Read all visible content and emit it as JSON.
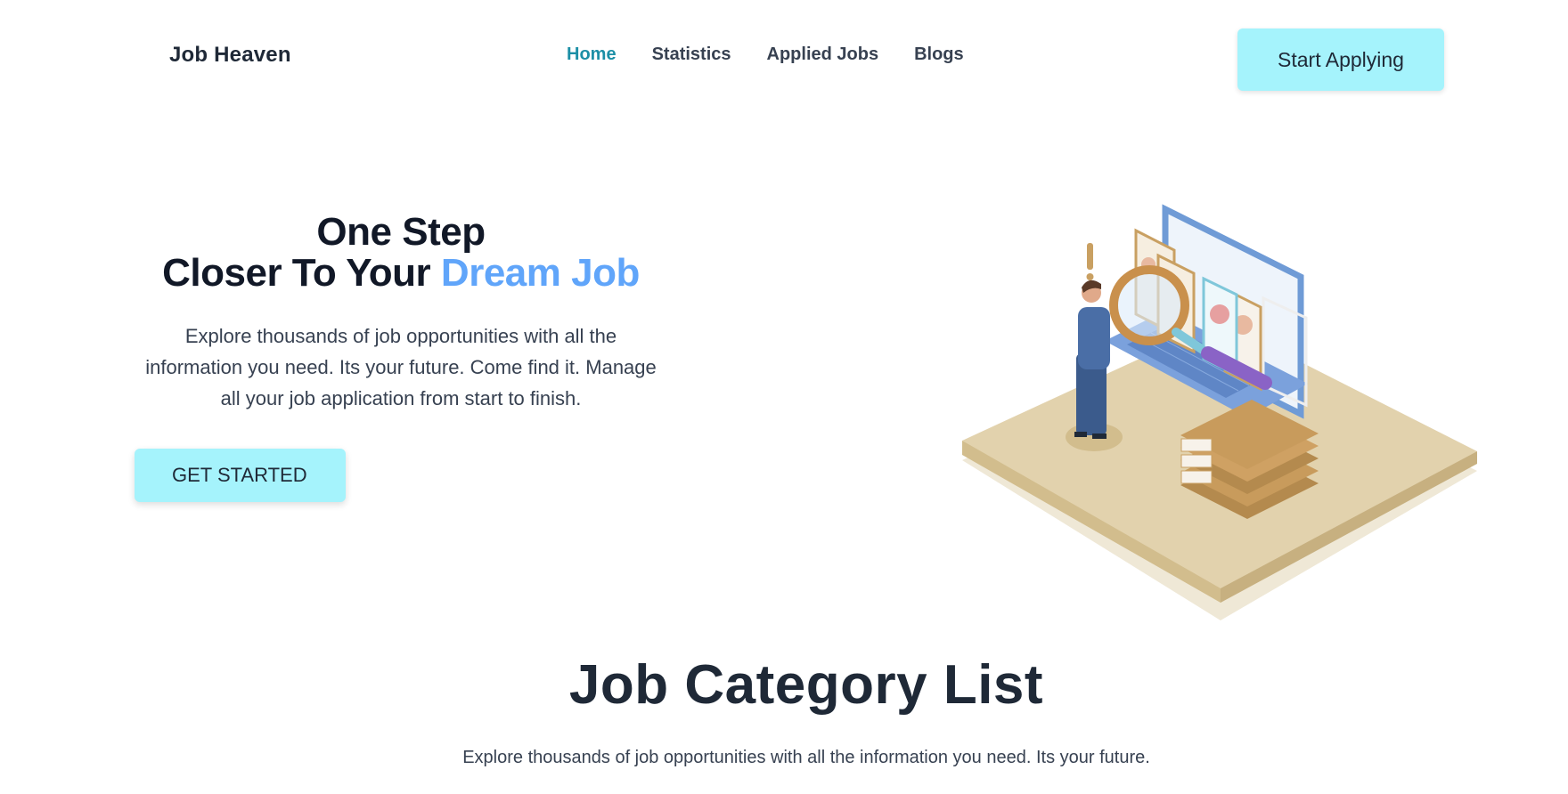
{
  "navbar": {
    "brand": "Job Heaven",
    "links": [
      {
        "label": "Home",
        "active": true
      },
      {
        "label": "Statistics",
        "active": false
      },
      {
        "label": "Applied Jobs",
        "active": false
      },
      {
        "label": "Blogs",
        "active": false
      }
    ],
    "cta_label": "Start Applying"
  },
  "hero": {
    "title_line1": "One Step",
    "title_line2_prefix": "Closer To Your ",
    "title_line2_accent": "Dream Job",
    "description": "Explore thousands of job opportunities with all the information you need. Its your future. Come find it. Manage all your job application from start to finish.",
    "button_label": "GET STARTED"
  },
  "category_section": {
    "title": "Job Category List",
    "description": "Explore thousands of job opportunities with all the information you need. Its your future."
  },
  "colors": {
    "accent_cyan": "#a5f3fc",
    "accent_blue": "#60a5fa",
    "active_link": "#1c8fa6",
    "text_dark": "#1f2937"
  }
}
